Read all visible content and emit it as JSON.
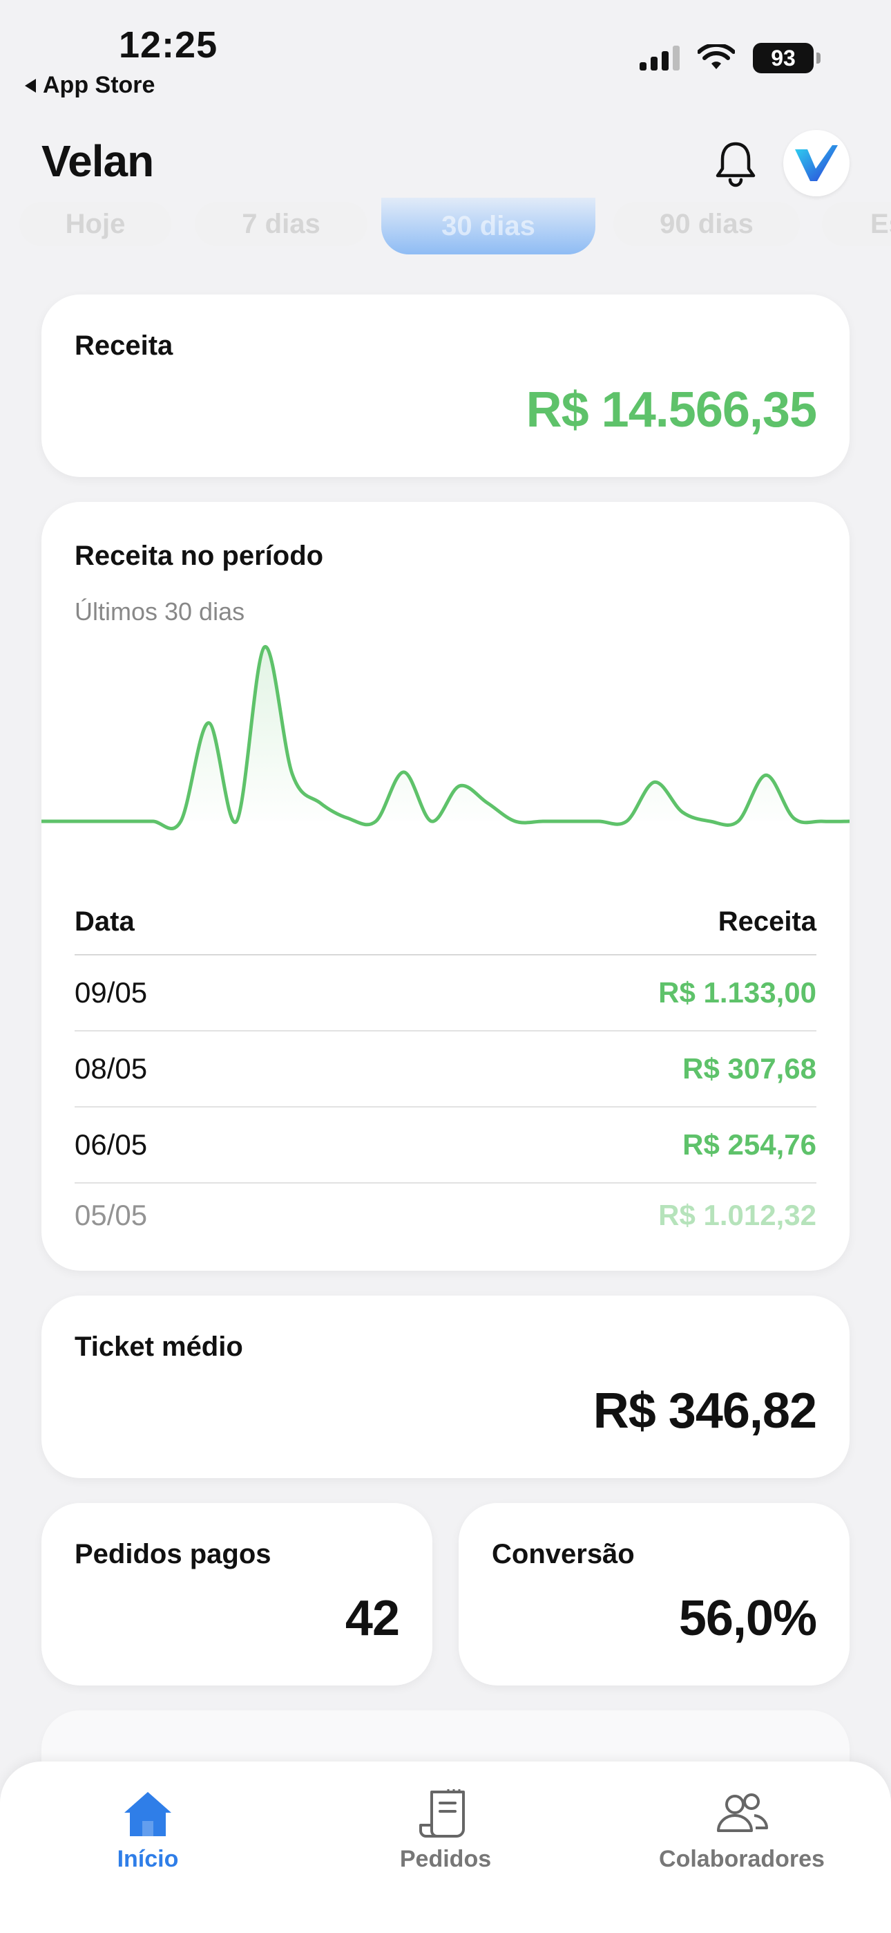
{
  "status_bar": {
    "time": "12:25",
    "back_label": "App Store",
    "battery": "93"
  },
  "header": {
    "title": "Velan"
  },
  "periods": [
    "Hoje",
    "7 dias",
    "30 dias",
    "90 dias",
    "Es"
  ],
  "revenue_card": {
    "label": "Receita",
    "value": "R$ 14.566,35"
  },
  "chart_card": {
    "title": "Receita no período",
    "subtitle": "Últimos 30 dias",
    "table": {
      "header": {
        "date": "Data",
        "revenue": "Receita"
      },
      "rows": [
        {
          "date": "09/05",
          "revenue": "R$ 1.133,00"
        },
        {
          "date": "08/05",
          "revenue": "R$ 307,68"
        },
        {
          "date": "06/05",
          "revenue": "R$ 254,76"
        },
        {
          "date": "05/05",
          "revenue": "R$ 1.012,32"
        }
      ]
    }
  },
  "chart_data": {
    "type": "area",
    "title": "Receita no período",
    "subtitle": "Últimos 30 dias",
    "x": [
      1,
      2,
      3,
      4,
      5,
      6,
      7,
      8,
      9,
      10,
      11,
      12,
      13,
      14,
      15,
      16,
      17,
      18,
      19,
      20,
      21,
      22,
      23,
      24,
      25,
      26,
      27,
      28,
      29,
      30
    ],
    "values": [
      0,
      0,
      0,
      0,
      0,
      0,
      640,
      0,
      1133,
      308,
      120,
      20,
      0,
      320,
      0,
      230,
      120,
      0,
      0,
      0,
      0,
      0,
      255,
      60,
      0,
      0,
      300,
      20,
      0,
      0
    ],
    "grid": false,
    "legend": "none",
    "color": "#5ec26a"
  },
  "ticket_card": {
    "label": "Ticket médio",
    "value": "R$ 346,82"
  },
  "orders_card": {
    "label": "Pedidos pagos",
    "value": "42"
  },
  "conversion_card": {
    "label": "Conversão",
    "value": "56,0%"
  },
  "tabbar": {
    "items": [
      {
        "label": "Início",
        "icon": "home-icon",
        "active": true
      },
      {
        "label": "Pedidos",
        "icon": "receipt-icon",
        "active": false
      },
      {
        "label": "Colaboradores",
        "icon": "people-icon",
        "active": false
      }
    ],
    "active_color": "#2f7ee8"
  },
  "colors": {
    "accent_green": "#5ec26a",
    "accent_blue": "#2f7ee8"
  }
}
